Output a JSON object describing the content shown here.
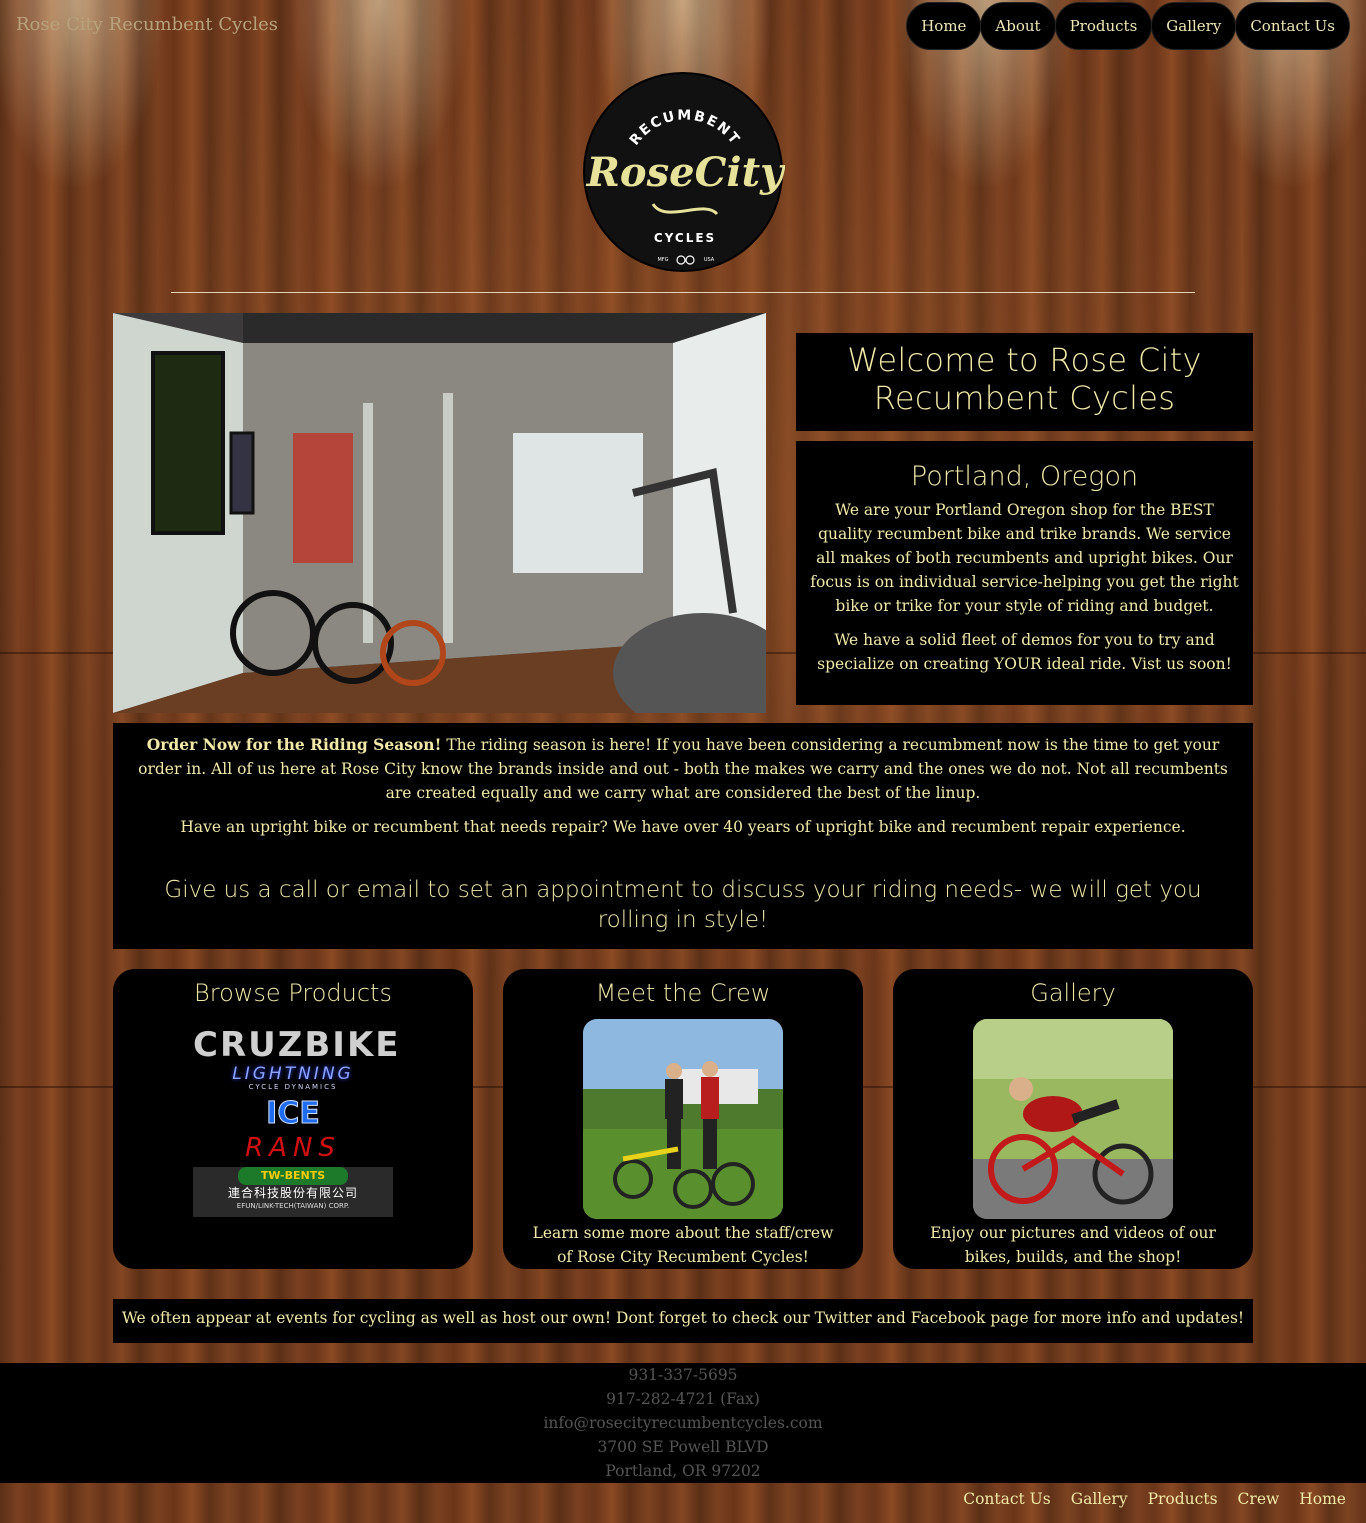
{
  "header": {
    "site_title": "Rose City Recumbent Cycles",
    "nav": [
      "Home",
      "About",
      "Products",
      "Gallery",
      "Contact Us"
    ]
  },
  "logo": {
    "top_text": "RECUMBENT",
    "main_text": "RoseCity",
    "bottom_text": "CYCLES",
    "left_small": "MFG",
    "right_small": "USA"
  },
  "welcome": {
    "title": "Welcome to Rose City Recumbent Cycles"
  },
  "intro": {
    "heading": "Portland, Oregon",
    "p1": "We are your Portland Oregon shop for the BEST quality recumbent bike and trike brands. We service all makes of both recumbents and upright bikes. Our focus is on individual service-helping you get the right bike or trike for your style of riding and budget.",
    "p2": "We have a solid fleet of demos for you to try and specialize on creating YOUR ideal ride. Vist us soon!"
  },
  "order": {
    "bold": "Order Now for the Riding Season!",
    "text": " The riding season is here! If you have been considering a recumbment now is the time to get your order in. All of us here at Rose City know the brands inside and out - both the makes we carry and the ones we do not. Not all recumbents are created equally and we carry what are considered the best of the linup.",
    "repair": "Have an upright bike or recumbent that needs repair? We have over 40 years of upright bike and recumbent repair experience.",
    "cta": "Give us a call or email to set an appointment to discuss your riding needs- we will get you rolling in style!"
  },
  "cards": {
    "products": {
      "title": "Browse Products",
      "brands": [
        "CRUZBIKE",
        "LIGHTNING",
        "CYCLE DYNAMICS",
        "ICE",
        "RANS",
        "TW-BENTS",
        "連合科技股份有限公司",
        "EFUN/LINK-TECH(TAIWAN) CORP."
      ]
    },
    "crew": {
      "title": "Meet the Crew",
      "text": "Learn some more about the staff/crew of Rose City Recumbent Cycles!"
    },
    "gallery": {
      "title": "Gallery",
      "text": "Enjoy our pictures and videos of our bikes, builds, and the shop!"
    }
  },
  "events": {
    "text": "We often appear at events for cycling as well as host our own! Dont forget to check our Twitter and Facebook page for more info and updates!"
  },
  "footer": {
    "phone": "931-337-5695",
    "fax": "917-282-4721 (Fax)",
    "email": "info@rosecityrecumbentcycles.com",
    "address1": "3700 SE Powell BLVD",
    "address2": "Portland, OR 97202",
    "nav": [
      "Contact Us",
      "Gallery",
      "Products",
      "Crew",
      "Home"
    ]
  },
  "colors": {
    "accent_text": "#f1e8a6",
    "panel_bg": "#000000",
    "wood": "#6a381b"
  }
}
